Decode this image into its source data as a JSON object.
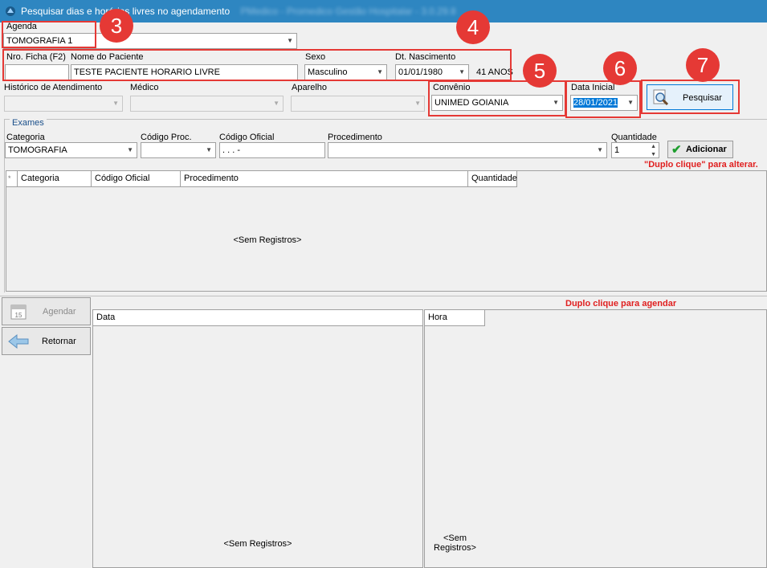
{
  "window": {
    "title": "Pesquisar dias e horários livres no agendamento",
    "title_suffix_blurred": "PMedico - Promedico Gestão Hospitalar - 3.0.29.8"
  },
  "agenda": {
    "label": "Agenda",
    "value": "TOMOGRAFIA 1"
  },
  "patient": {
    "ficha_label": "Nro. Ficha (F2)",
    "ficha_value": "",
    "name_label": "Nome do Paciente",
    "name_value": "TESTE PACIENTE HORARIO LIVRE",
    "sexo_label": "Sexo",
    "sexo_value": "Masculino",
    "nasc_label": "Dt. Nascimento",
    "nasc_value": "01/01/1980",
    "age": "41 ANOS"
  },
  "row3": {
    "historico_label": "Histórico de Atendimento",
    "medico_label": "Médico",
    "aparelho_label": "Aparelho",
    "convenio_label": "Convênio",
    "convenio_value": "UNIMED GOIANIA",
    "data_inicial_label": "Data Inicial",
    "data_inicial_value": "28/01/2021",
    "pesquisar_label": "Pesquisar"
  },
  "exames": {
    "group_title": "Exames",
    "categoria_label": "Categoria",
    "categoria_value": "TOMOGRAFIA",
    "cod_proc_label": "Código Proc.",
    "cod_oficial_label": "Código Oficial",
    "cod_oficial_value": ". . . -",
    "procedimento_label": "Procedimento",
    "quantidade_label": "Quantidade",
    "quantidade_value": "1",
    "adicionar_label": "Adicionar",
    "hint": "\"Duplo clique\" para alterar.",
    "columns": [
      "Categoria",
      "Código Oficial",
      "Procedimento",
      "Quantidade"
    ],
    "empty": "<Sem Registros>"
  },
  "bottom": {
    "agendar_label": "Agendar",
    "retornar_label": "Retornar",
    "hint": "Duplo clique para agendar",
    "data_header": "Data",
    "hora_header": "Hora",
    "data_empty": "<Sem Registros>",
    "hora_empty_line1": "<Sem",
    "hora_empty_line2": "Registros>"
  },
  "annotations": [
    "3",
    "4",
    "5",
    "6",
    "7"
  ],
  "colors": {
    "titlebar": "#2e86c1",
    "annotation": "#e53935",
    "hint": "#e02020",
    "selection": "#0078d7"
  }
}
